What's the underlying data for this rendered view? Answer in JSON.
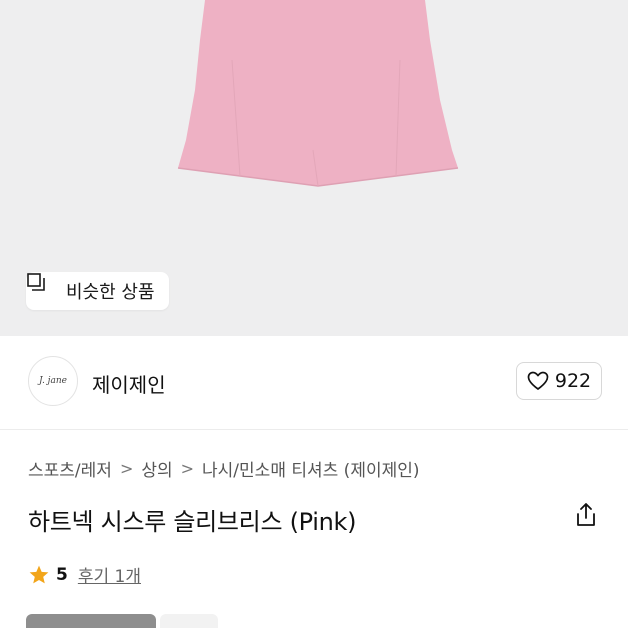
{
  "product_image": {
    "similar_button_label": "비슷한 상품",
    "garment_color": "#eeb1c4"
  },
  "seller": {
    "avatar_text": "J. jane",
    "name": "제이제인",
    "likes": "922"
  },
  "breadcrumb": {
    "items": [
      "스포츠/레저",
      "상의",
      "나시/민소매 티셔츠 (제이제인)"
    ],
    "separator": ">"
  },
  "product": {
    "title": "하트넥 시스루 슬리브리스 (Pink)"
  },
  "rating": {
    "score": "5",
    "reviews_label": "후기 1개",
    "star_color": "#f2a51a"
  }
}
